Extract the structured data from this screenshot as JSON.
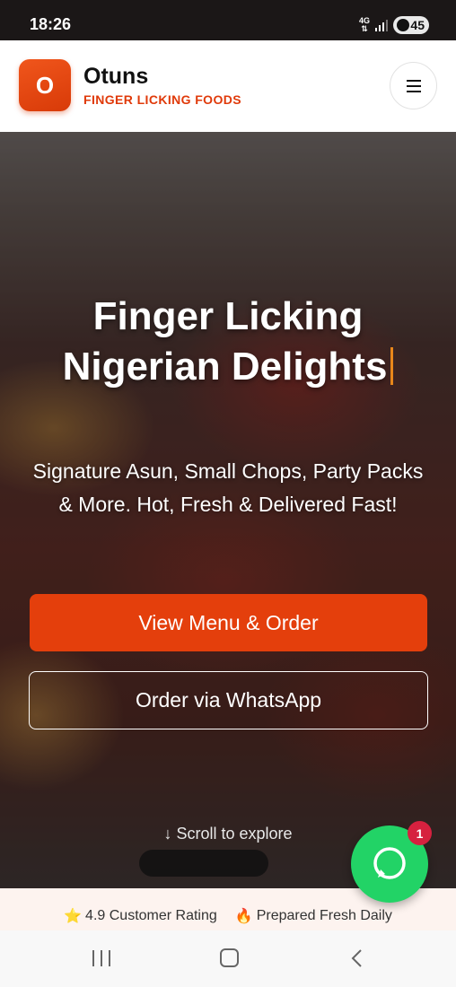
{
  "status_bar": {
    "time": "18:26",
    "network": "4G",
    "battery": "45"
  },
  "header": {
    "logo_letter": "O",
    "brand_name": "Otuns",
    "tagline": "FINGER LICKING FOODS",
    "menu_icon": "hamburger-menu-icon"
  },
  "hero": {
    "title_line1": "Finger Licking",
    "title_line2": "Nigerian Delights",
    "subtitle": "Signature Asun, Small Chops, Party Packs & More. Hot, Fresh & Delivered Fast!",
    "primary_button": "View Menu & Order",
    "secondary_button": "Order via WhatsApp",
    "scroll_hint": "↓ Scroll to explore"
  },
  "whatsapp": {
    "icon": "whatsapp-icon",
    "badge_count": "1",
    "color": "#22d366"
  },
  "rating_strip": {
    "rating_icon": "⭐",
    "rating_text": "4.9 Customer Rating",
    "fresh_icon": "🔥",
    "fresh_text": "Prepared Fresh Daily"
  },
  "colors": {
    "accent": "#e43f0c",
    "tagline": "#e03a0a",
    "badge": "#d6213f"
  }
}
